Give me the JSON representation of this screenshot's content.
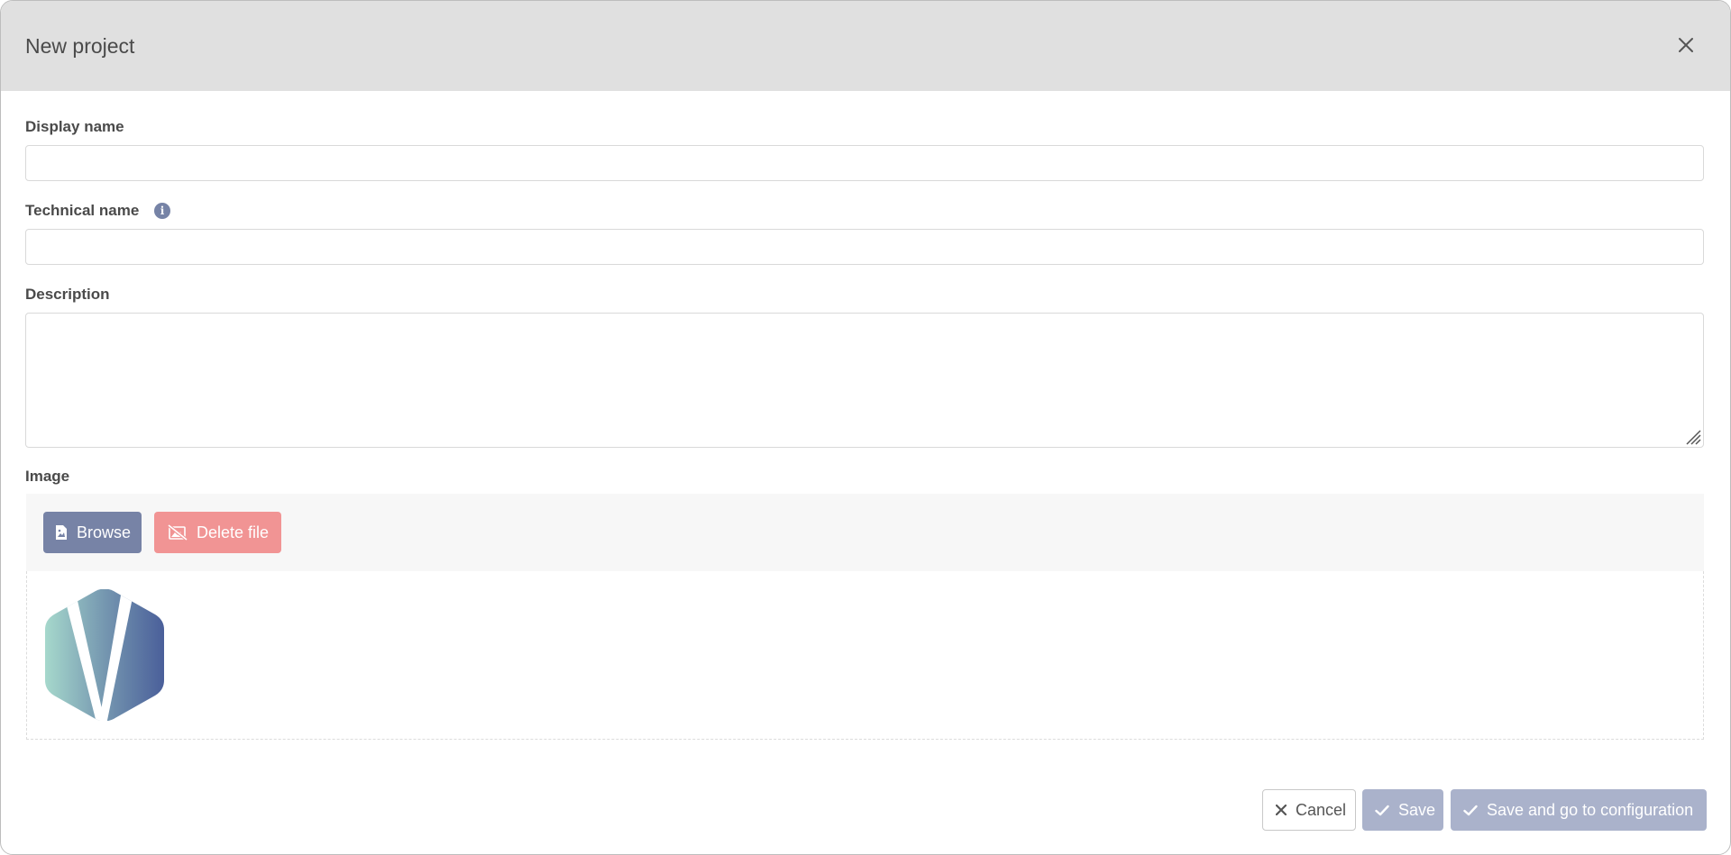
{
  "dialog": {
    "title": "New project",
    "close_icon": "close-icon"
  },
  "form": {
    "display_name": {
      "label": "Display name",
      "value": "",
      "placeholder": ""
    },
    "technical_name": {
      "label": "Technical name",
      "value": "",
      "placeholder": "",
      "info_icon": "info-icon"
    },
    "description": {
      "label": "Description",
      "value": "",
      "placeholder": ""
    },
    "image": {
      "label": "Image",
      "browse_label": "Browse",
      "browse_icon": "file-image-icon",
      "delete_label": "Delete file",
      "delete_icon": "image-slash-icon",
      "preview": "logo-image"
    }
  },
  "footer": {
    "cancel_label": "Cancel",
    "cancel_icon": "x-icon",
    "save_label": "Save",
    "save_icon": "check-icon",
    "save_config_label": "Save and go to configuration",
    "save_config_icon": "check-icon"
  },
  "colors": {
    "header_bg": "#e0e0e0",
    "primary": "#7783a6",
    "danger": "#f19494",
    "disabled_primary": "#aab2cb"
  }
}
